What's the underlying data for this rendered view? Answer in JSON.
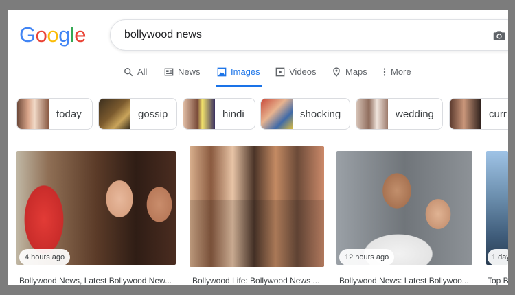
{
  "logo": {
    "letters": [
      "G",
      "o",
      "o",
      "g",
      "l",
      "e"
    ],
    "colors": [
      "#4285f4",
      "#ea4335",
      "#fbbc05",
      "#4285f4",
      "#34a853",
      "#ea4335"
    ]
  },
  "search": {
    "query": "bollywood news",
    "icon": "camera-icon"
  },
  "tabs": [
    {
      "label": "All",
      "icon": "search-icon"
    },
    {
      "label": "News",
      "icon": "news-icon"
    },
    {
      "label": "Images",
      "icon": "image-icon",
      "active": true
    },
    {
      "label": "Videos",
      "icon": "play-icon"
    },
    {
      "label": "Maps",
      "icon": "map-pin-icon"
    },
    {
      "label": "More",
      "icon": "more-vertical-icon"
    }
  ],
  "chips": [
    {
      "label": "today"
    },
    {
      "label": "gossip"
    },
    {
      "label": "hindi"
    },
    {
      "label": "shocking"
    },
    {
      "label": "wedding"
    },
    {
      "label": "curr"
    }
  ],
  "results": [
    {
      "time": "4 hours ago",
      "title": "Bollywood News, Latest Bollywood New..."
    },
    {
      "time": "",
      "title": "Bollywood Life: Bollywood News ..."
    },
    {
      "time": "12 hours ago",
      "title": "Bollywood News: Latest Bollywoo..."
    },
    {
      "time": "1 day",
      "title": "Top B"
    }
  ],
  "colors": {
    "accent": "#1a73e8",
    "text": "#3c4043",
    "muted": "#5f6368"
  }
}
